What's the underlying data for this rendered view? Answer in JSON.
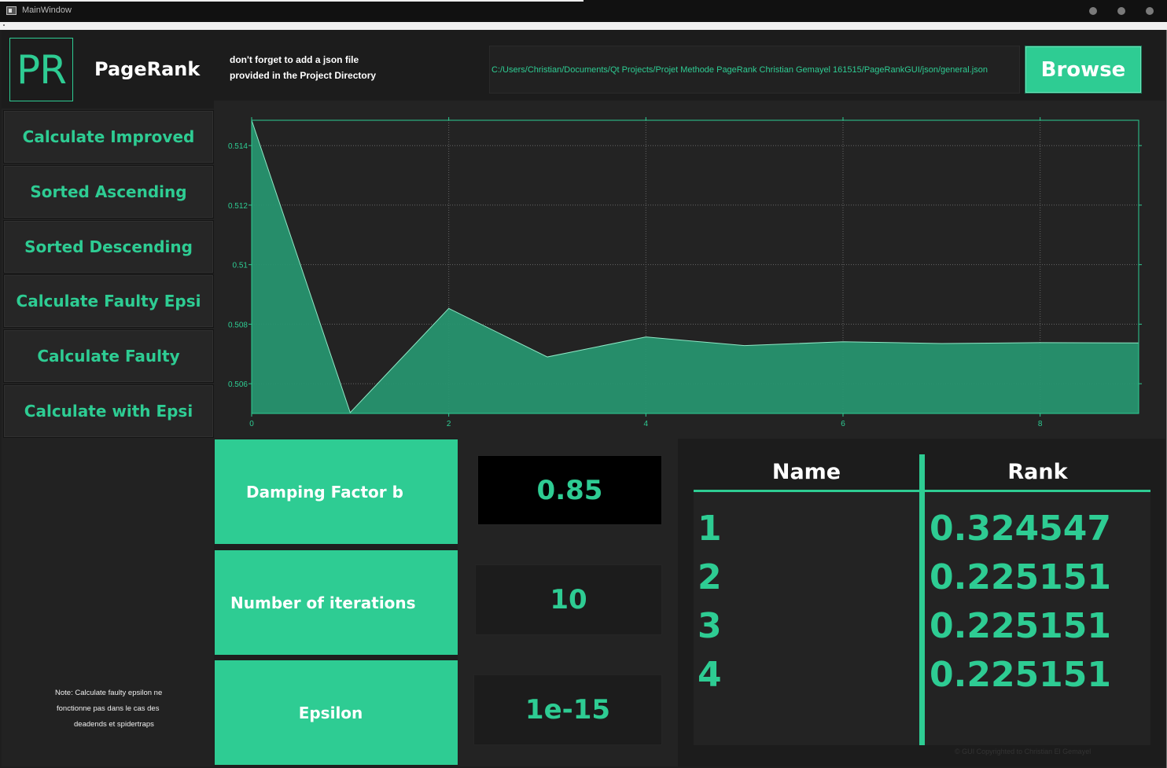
{
  "window": {
    "title": "MainWindow"
  },
  "sidebar": {
    "logo": "PR",
    "app_name": "PageRank",
    "buttons": [
      "Calculate Improved",
      "Sorted Ascending",
      "Sorted Descending",
      "Calculate Faulty Epsi",
      "Calculate Faulty",
      "Calculate with Epsi"
    ],
    "note": [
      "Note: Calculate faulty epsilon ne",
      "fonctionne pas dans le cas des",
      "deadends et spidertraps"
    ]
  },
  "header": {
    "hint": [
      "don't forget to add a json file",
      "provided in the Project Directory"
    ],
    "path": "C:/Users/Christian/Documents/Qt Projects/Projet Methode PageRank Christian Gemayel 161515/PageRankGUI/json/general.json",
    "browse_label": "Browse"
  },
  "chart_data": {
    "type": "area",
    "x": [
      0,
      1,
      2,
      3,
      4,
      5,
      6,
      7,
      8,
      9
    ],
    "values": [
      0.51485,
      0.50503,
      0.50853,
      0.5069,
      0.50757,
      0.50728,
      0.50741,
      0.50735,
      0.50738,
      0.50737
    ],
    "xlim": [
      0,
      9
    ],
    "ylim": [
      0.505,
      0.51485
    ],
    "x_ticks": [
      "0",
      "2",
      "4",
      "6",
      "8"
    ],
    "y_ticks": [
      "0.506",
      "0.508",
      "0.51",
      "0.512",
      "0.514"
    ],
    "grid": true,
    "colors": {
      "fill": "#27946f",
      "line": "#2ecc93",
      "grid": "#666666"
    }
  },
  "params": {
    "damping_label": "Damping Factor b",
    "damping_value": "0.85",
    "iterations_label": "Number of iterations",
    "iterations_value": "10",
    "epsilon_label": "Epsilon",
    "epsilon_value": "1e-15"
  },
  "table": {
    "headers": [
      "Name",
      "Rank"
    ],
    "rows": [
      {
        "name": "1",
        "rank": "0.324547"
      },
      {
        "name": "2",
        "rank": "0.225151"
      },
      {
        "name": "3",
        "rank": "0.225151"
      },
      {
        "name": "4",
        "rank": "0.225151"
      }
    ],
    "copyright": "© GUI Copyrighted to Christian El Gemayel"
  },
  "colors": {
    "accent": "#2ecc93",
    "background": "#1e1e1e"
  }
}
